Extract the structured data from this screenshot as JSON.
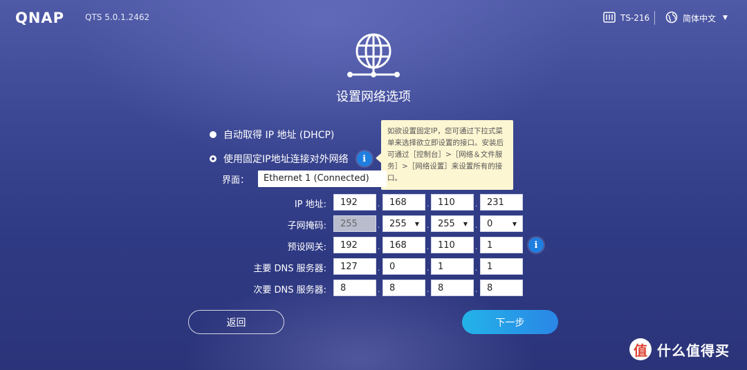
{
  "header": {
    "logo": "QNAP",
    "version": "QTS 5.0.1.2462",
    "device": "TS-216",
    "language": "简体中文"
  },
  "page": {
    "title": "设置网络选项"
  },
  "options": {
    "dhcp_label": "自动取得 IP 地址 (DHCP)",
    "static_label": "使用固定IP地址连接对外网络",
    "info_glyph": "i"
  },
  "tooltip": {
    "text": "如欲设置固定IP，您可通过下拉式菜单来选择欲立即设置的接口。安装后可通过［控制台］>［网络＆文件服务］>［网络设置］来设置所有的接口。"
  },
  "interface": {
    "label": "界面：",
    "value": "Ethernet 1 (Connected)"
  },
  "fields": {
    "ip": {
      "label": "IP 地址:",
      "octets": [
        "192",
        "168",
        "110",
        "231"
      ]
    },
    "subnet": {
      "label": "子网掩码:",
      "octets": [
        "255",
        "255",
        "255",
        "0"
      ]
    },
    "gateway": {
      "label": "预设网关:",
      "octets": [
        "192",
        "168",
        "110",
        "1"
      ]
    },
    "dns1": {
      "label": "主要 DNS 服务器:",
      "octets": [
        "127",
        "0",
        "1",
        "1"
      ]
    },
    "dns2": {
      "label": "次要 DNS 服务器:",
      "octets": [
        "8",
        "8",
        "8",
        "8"
      ]
    }
  },
  "buttons": {
    "back": "返回",
    "next": "下一步"
  },
  "watermark": {
    "glyph": "值",
    "text": "什么值得买"
  },
  "colors": {
    "accent": "#1f7fe0",
    "next_button": "#23b3e8",
    "tooltip_bg": "#fdf6d2"
  }
}
